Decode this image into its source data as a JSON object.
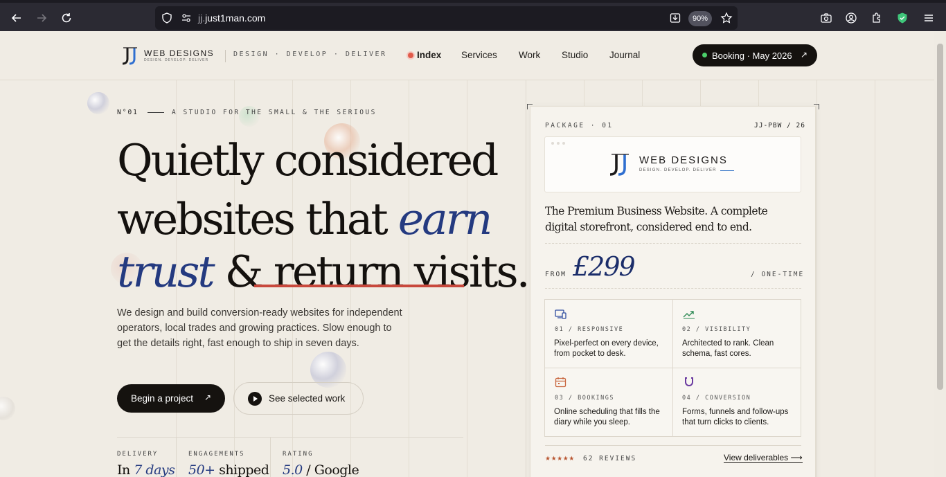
{
  "browser": {
    "url_prefix": "jj.",
    "url_main": "just1man.com",
    "zoom": "90%"
  },
  "header": {
    "logo_word": "WEB DESIGNS",
    "logo_sub": "DESIGN. DEVELOP. DELIVER",
    "tagline": "DESIGN · DEVELOP · DELIVER",
    "nav": [
      "Index",
      "Services",
      "Work",
      "Studio",
      "Journal"
    ],
    "booking": "Booking · May 2026",
    "booking_arrow": "↗"
  },
  "hero": {
    "eyebrow_num": "N°01",
    "eyebrow_text": "A STUDIO FOR THE SMALL & THE SERIOUS",
    "line1": "Quietly considered",
    "line2_a": "websites that ",
    "line2_b": "earn",
    "line3_a": "trust",
    "line3_b": " & ",
    "line3_c": "return visits",
    "line3_d": ".",
    "description": "We design and build conversion-ready websites for independent operators, local trades and growing practices. Slow enough to get the details right, fast enough to ship in seven days.",
    "cta_primary": "Begin a project",
    "cta_primary_arrow": "↗",
    "cta_secondary": "See selected work"
  },
  "stats": [
    {
      "label": "DELIVERY",
      "a": "In ",
      "b": "7 days",
      "c": ""
    },
    {
      "label": "ENGAGEMENTS",
      "a": "",
      "b": "50+",
      "c": " shipped"
    },
    {
      "label": "RATING",
      "a": "",
      "b": "5.0",
      "c": " / Google"
    }
  ],
  "card": {
    "package_label": "PACKAGE · 01",
    "package_code": "JJ-PBW / 26",
    "logo_word": "WEB DESIGNS",
    "logo_sub": "DESIGN. DEVELOP. DELIVER",
    "description": "The Premium Business Website. A complete digital storefront, considered end to end.",
    "from_label": "FROM",
    "price": "£299",
    "price_sub": "/ ONE-TIME",
    "features": [
      {
        "icon": "devices-icon",
        "label": "01 / RESPONSIVE",
        "text": "Pixel-perfect on every device, from pocket to desk."
      },
      {
        "icon": "trend-up-icon",
        "label": "02 / VISIBILITY",
        "text": "Architected to rank. Clean schema, fast cores."
      },
      {
        "icon": "calendar-icon",
        "label": "03 / BOOKINGS",
        "text": "Online scheduling that fills the diary while you sleep."
      },
      {
        "icon": "magnet-icon",
        "label": "04 / CONVERSION",
        "text": "Forms, funnels and follow-ups that turn clicks to clients."
      }
    ],
    "stars": "★★★★★",
    "reviews": "62 REVIEWS",
    "view_link": "View deliverables ⟶"
  },
  "colors": {
    "accent_blue": "#243a80",
    "underline_red": "#c8483c",
    "dark": "#15120f",
    "background": "#f0ece4"
  }
}
